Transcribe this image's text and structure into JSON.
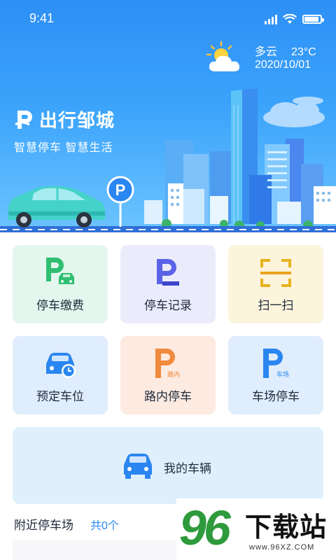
{
  "status_bar": {
    "time": "9:41"
  },
  "weather": {
    "condition": "多云",
    "temperature": "23°C",
    "date": "2020/10/01",
    "icon": "partly-cloudy-icon"
  },
  "brand": {
    "title": "出行邹城",
    "slogan": "智慧停车  智慧生活"
  },
  "services": [
    {
      "label": "停车缴费",
      "icon": "parking-pay-icon"
    },
    {
      "label": "停车记录",
      "icon": "parking-record-icon"
    },
    {
      "label": "扫一扫",
      "icon": "scan-icon"
    },
    {
      "label": "预定车位",
      "icon": "reserve-spot-icon"
    },
    {
      "label": "路内停车",
      "icon": "street-parking-icon"
    },
    {
      "label": "车场停车",
      "icon": "lot-parking-icon"
    }
  ],
  "my_vehicle": {
    "label": "我的车辆",
    "icon": "car-icon"
  },
  "nearby": {
    "title": "附近停车场",
    "count_text": "共0个"
  },
  "watermark": {
    "number": "96",
    "text": "下载站",
    "url": "www.96XZ.COM"
  },
  "colors": {
    "primary": "#2a86f0",
    "green": "#2fbf71",
    "orange": "#f08a3c",
    "yellow": "#e8b21e"
  }
}
